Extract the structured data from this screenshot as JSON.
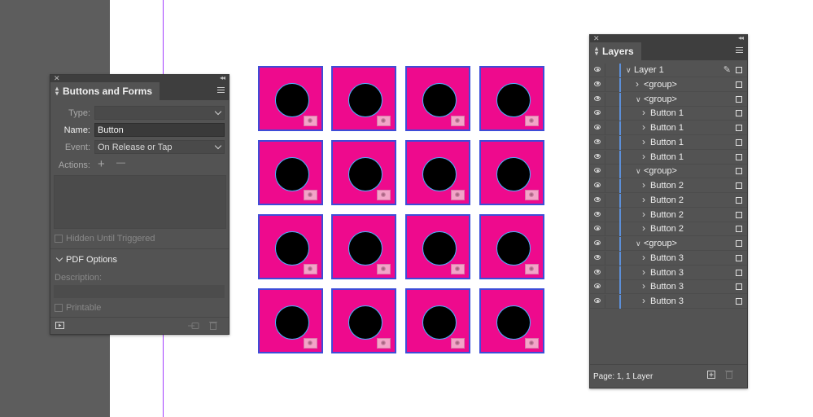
{
  "buttons_forms_panel": {
    "title": "Buttons and Forms",
    "type_label": "Type:",
    "type_value": "",
    "name_label": "Name:",
    "name_value": "Button",
    "event_label": "Event:",
    "event_value": "On Release or Tap",
    "actions_label": "Actions:",
    "add_symbol": "+",
    "remove_symbol": "—",
    "hidden_until_triggered": "Hidden Until Triggered",
    "pdf_options": "PDF Options",
    "description_label": "Description:",
    "printable": "Printable"
  },
  "layers_panel": {
    "title": "Layers",
    "footer": "Page: 1, 1 Layer",
    "rows": [
      {
        "label": "Layer 1",
        "indent": 0,
        "expanded": true
      },
      {
        "label": "<group>",
        "indent": 1,
        "expanded": false
      },
      {
        "label": "<group>",
        "indent": 1,
        "expanded": true
      },
      {
        "label": "Button 1",
        "indent": 2,
        "expanded": false
      },
      {
        "label": "Button 1",
        "indent": 2,
        "expanded": false
      },
      {
        "label": "Button 1",
        "indent": 2,
        "expanded": false
      },
      {
        "label": "Button 1",
        "indent": 2,
        "expanded": false
      },
      {
        "label": "<group>",
        "indent": 1,
        "expanded": true
      },
      {
        "label": "Button 2",
        "indent": 2,
        "expanded": false
      },
      {
        "label": "Button 2",
        "indent": 2,
        "expanded": false
      },
      {
        "label": "Button 2",
        "indent": 2,
        "expanded": false
      },
      {
        "label": "Button 2",
        "indent": 2,
        "expanded": false
      },
      {
        "label": "<group>",
        "indent": 1,
        "expanded": true
      },
      {
        "label": "Button 3",
        "indent": 2,
        "expanded": false
      },
      {
        "label": "Button 3",
        "indent": 2,
        "expanded": false
      },
      {
        "label": "Button 3",
        "indent": 2,
        "expanded": false
      },
      {
        "label": "Button 3",
        "indent": 2,
        "expanded": false
      }
    ]
  },
  "artwork": {
    "rows": 4,
    "cols": 4,
    "tile_color": "#ee0a8d",
    "frame_color": "#3e4cd8",
    "circle_color": "#000000"
  },
  "colors": {
    "panel_bg": "#535353",
    "pasteboard": "#5d5d5d",
    "guide": "#a23dff",
    "layer_color": "#5c8fd8"
  }
}
